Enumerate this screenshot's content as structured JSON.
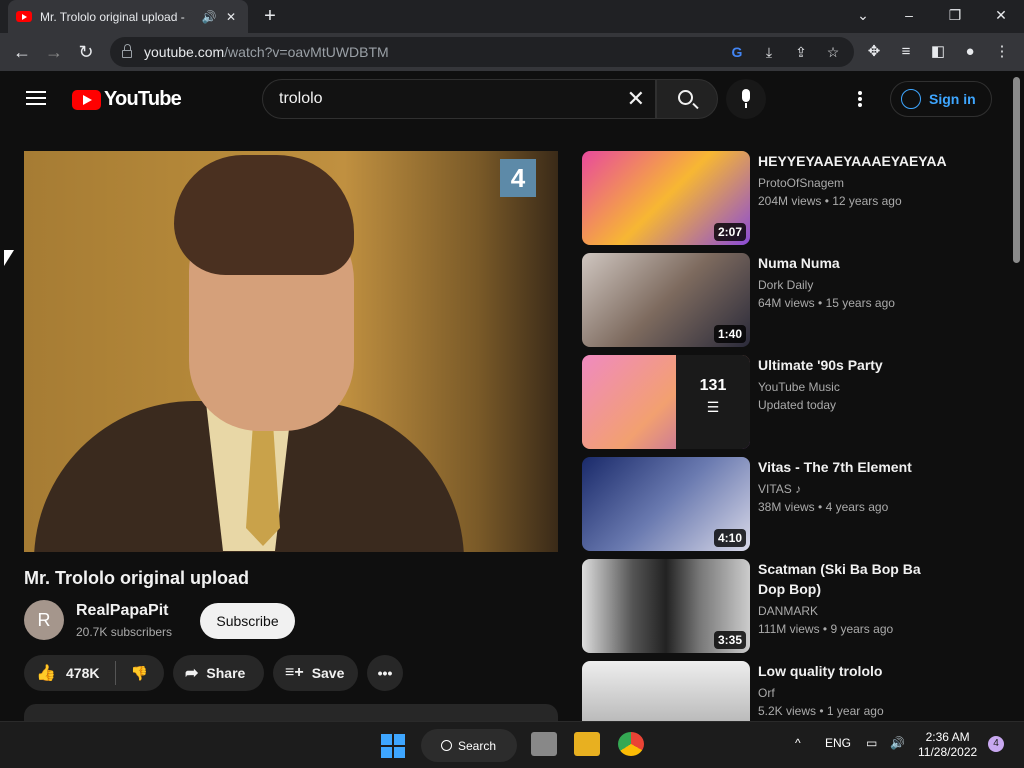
{
  "browser": {
    "tab_title": "Mr. Trololo original upload -",
    "url_host": "youtube.com",
    "url_path": "/watch?v=oavMtUWDBTM"
  },
  "header": {
    "logo_text": "YouTube",
    "search_value": "trololo",
    "signin_label": "Sign in"
  },
  "video": {
    "title": "Mr. Trololo original upload",
    "channel_name": "RealPapaPit",
    "channel_initial": "R",
    "subscribers": "20.7K subscribers",
    "subscribe_label": "Subscribe",
    "likes": "478K",
    "share_label": "Share",
    "save_label": "Save",
    "player_channel_badge": "4"
  },
  "related": [
    {
      "title": "HEYYEYAAEYAAAEYAEYAA",
      "channel": "ProtoOfSnagem",
      "views": "204M views",
      "age": "12 years ago",
      "duration": "2:07"
    },
    {
      "title": "Numa Numa",
      "channel": "Dork Daily",
      "views": "64M views",
      "age": "15 years ago",
      "duration": "1:40"
    },
    {
      "title": "Ultimate '90s Party",
      "channel": "YouTube Music",
      "meta": "Updated today",
      "playlist_count": "131"
    },
    {
      "title": "Vitas - The 7th Element",
      "channel": "VITAS",
      "views": "38M views",
      "age": "4 years ago",
      "duration": "4:10"
    },
    {
      "title": "Scatman (Ski Ba Bop Ba Dop Bop)",
      "channel": "DANMARK",
      "views": "111M views",
      "age": "9 years ago",
      "duration": "3:35"
    },
    {
      "title": "Low quality trololo",
      "channel": "Orf",
      "views": "5.2K views",
      "age": "1 year ago"
    }
  ],
  "taskbar": {
    "search_label": "Search",
    "language": "ENG",
    "time": "2:36 AM",
    "date": "11/28/2022",
    "notifications": "4"
  }
}
